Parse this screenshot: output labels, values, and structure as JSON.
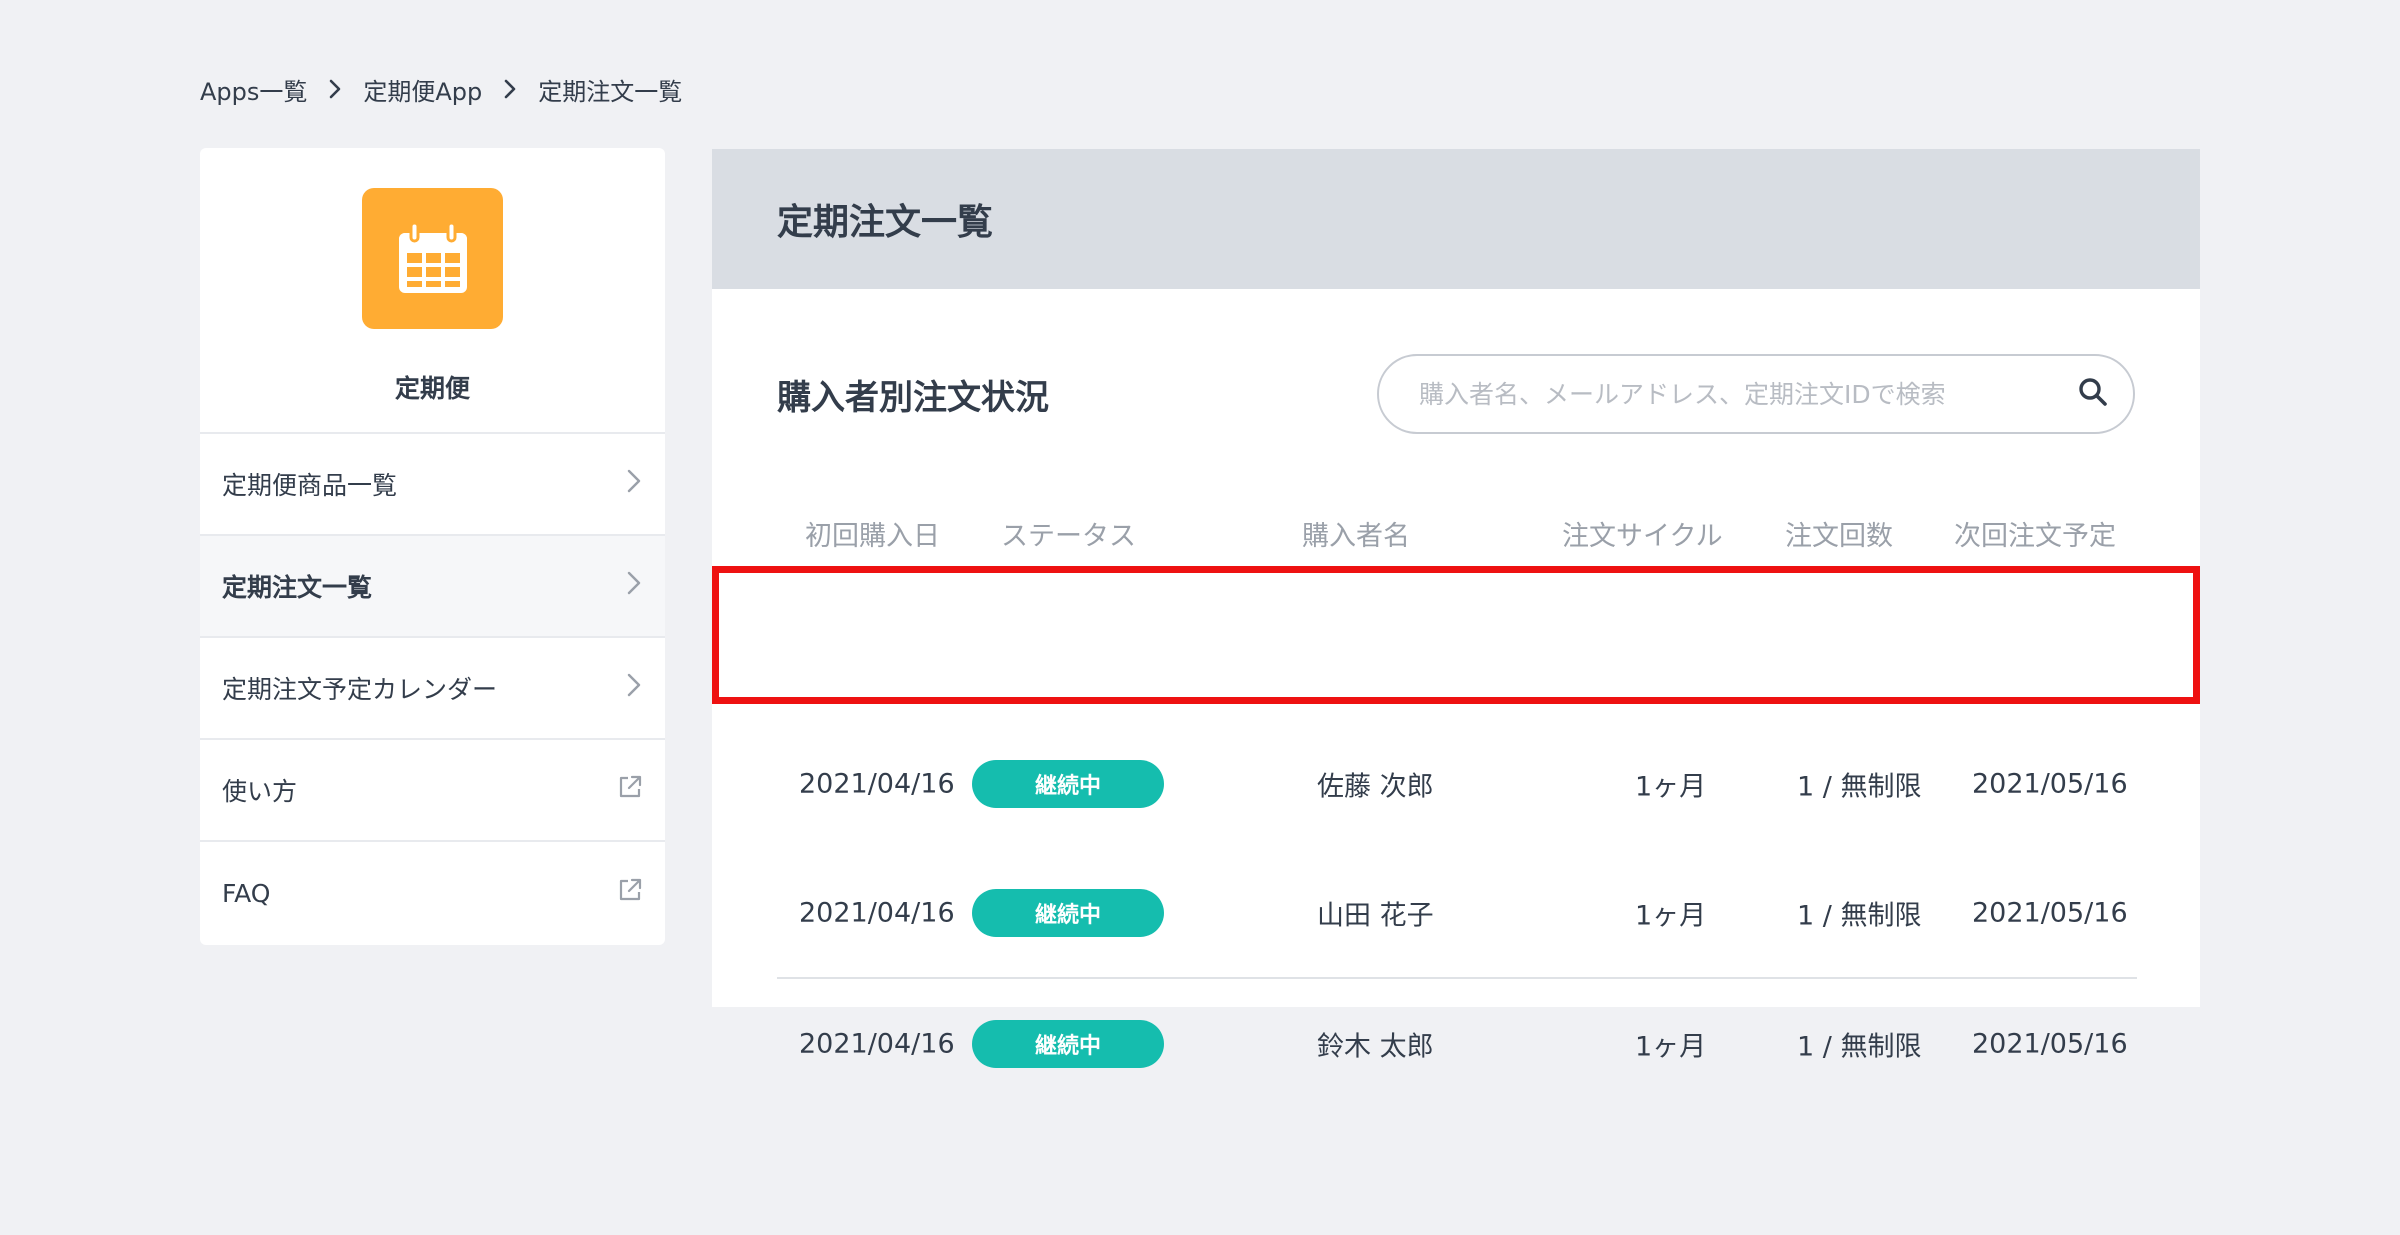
{
  "breadcrumb": [
    "Apps一覧",
    "定期便App",
    "定期注文一覧"
  ],
  "sidebar": {
    "app_name": "定期便",
    "items": [
      {
        "label": "定期便商品一覧",
        "icon": "chevron-right-icon"
      },
      {
        "label": "定期注文一覧",
        "icon": "chevron-right-icon",
        "active": true
      },
      {
        "label": "定期注文予定カレンダー",
        "icon": "chevron-right-icon"
      },
      {
        "label": "使い方",
        "icon": "external-link-icon"
      },
      {
        "label": "FAQ",
        "icon": "external-link-icon"
      }
    ]
  },
  "main": {
    "header_title": "定期注文一覧",
    "section_title": "購入者別注文状況",
    "search_placeholder": "購入者名、メールアドレス、定期注文IDで検索",
    "columns": [
      "初回購入日",
      "ステータス",
      "購入者名",
      "注文サイクル",
      "注文回数",
      "次回注文予定"
    ],
    "rows": [
      {
        "first_date": "2021/04/16",
        "status": "継続中",
        "buyer": "佐藤 次郎",
        "cycle": "1ヶ月",
        "count": "1 / 無制限",
        "next_date": "2021/05/16"
      },
      {
        "first_date": "2021/04/16",
        "status": "継続中",
        "buyer": "山田 花子",
        "cycle": "1ヶ月",
        "count": "1 / 無制限",
        "next_date": "2021/05/16"
      },
      {
        "first_date": "2021/04/16",
        "status": "継続中",
        "buyer": "鈴木 太郎",
        "cycle": "1ヶ月",
        "count": "1 / 無制限",
        "next_date": "2021/05/16"
      }
    ]
  },
  "colors": {
    "app_icon": "#ffac33",
    "status_badge": "#15bdae",
    "highlight": "#ee1111",
    "header_band": "#d9dde3"
  }
}
